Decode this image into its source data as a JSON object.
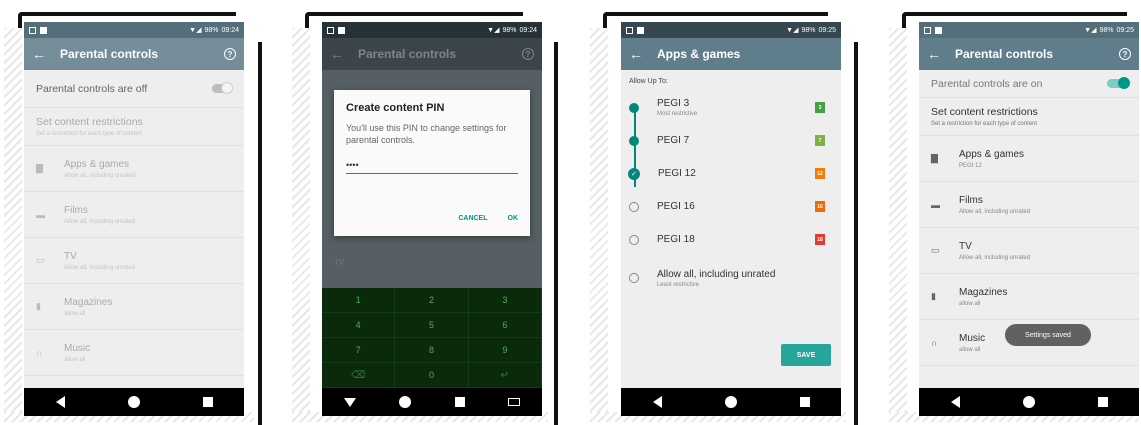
{
  "status": {
    "screen1_time": "09:24",
    "screen2_time": "09:24",
    "screen3_time": "09:25",
    "screen4_time": "09:25",
    "battery": "98%"
  },
  "screen1": {
    "title": "Parental controls",
    "toggle_label": "Parental controls are off",
    "section_title": "Set content restrictions",
    "section_subtitle": "Set a restriction for each type of content",
    "items": [
      {
        "label": "Apps & games",
        "sub": "Allow all, including unrated"
      },
      {
        "label": "Films",
        "sub": "Allow all, including unrated"
      },
      {
        "label": "TV",
        "sub": "Allow all, including unrated"
      },
      {
        "label": "Magazines",
        "sub": "allow all"
      },
      {
        "label": "Music",
        "sub": "allow all"
      }
    ]
  },
  "screen2": {
    "title": "Parental controls",
    "dialog_title": "Create content PIN",
    "dialog_body": "You'll use this PIN to change settings for parental controls.",
    "pin_value": "••••",
    "cancel": "CANCEL",
    "ok": "OK",
    "under_label": "TV",
    "keys": [
      "1",
      "2",
      "3",
      "4",
      "5",
      "6",
      "7",
      "8",
      "9",
      "⌫",
      "0",
      "↵"
    ]
  },
  "screen3": {
    "title": "Apps & games",
    "allow_up_to": "Allow Up To:",
    "ratings": [
      {
        "name": "PEGI 3",
        "sub": "Most restrictive",
        "badge": "3",
        "color": "#43a047"
      },
      {
        "name": "PEGI 7",
        "sub": "",
        "badge": "7",
        "color": "#7cb342"
      },
      {
        "name": "PEGI 12",
        "sub": "",
        "badge": "12",
        "color": "#f57c00"
      },
      {
        "name": "PEGI 16",
        "sub": "",
        "badge": "16",
        "color": "#ef6c00"
      },
      {
        "name": "PEGI 18",
        "sub": "",
        "badge": "18",
        "color": "#e53935"
      },
      {
        "name": "Allow all, including unrated",
        "sub": "Least restrictive",
        "badge": "",
        "color": ""
      }
    ],
    "selected": "PEGI 12",
    "save": "SAVE"
  },
  "screen4": {
    "title": "Parental controls",
    "toggle_label": "Parental controls are on",
    "section_title": "Set content restrictions",
    "section_subtitle": "Set a restriction for each type of content",
    "items": [
      {
        "label": "Apps & games",
        "sub": "PEGI 12"
      },
      {
        "label": "Films",
        "sub": "Allow all, including unrated"
      },
      {
        "label": "TV",
        "sub": "Allow all, including unrated"
      },
      {
        "label": "Magazines",
        "sub": "allow all"
      },
      {
        "label": "Music",
        "sub": "allow all"
      }
    ],
    "toast": "Settings saved"
  }
}
